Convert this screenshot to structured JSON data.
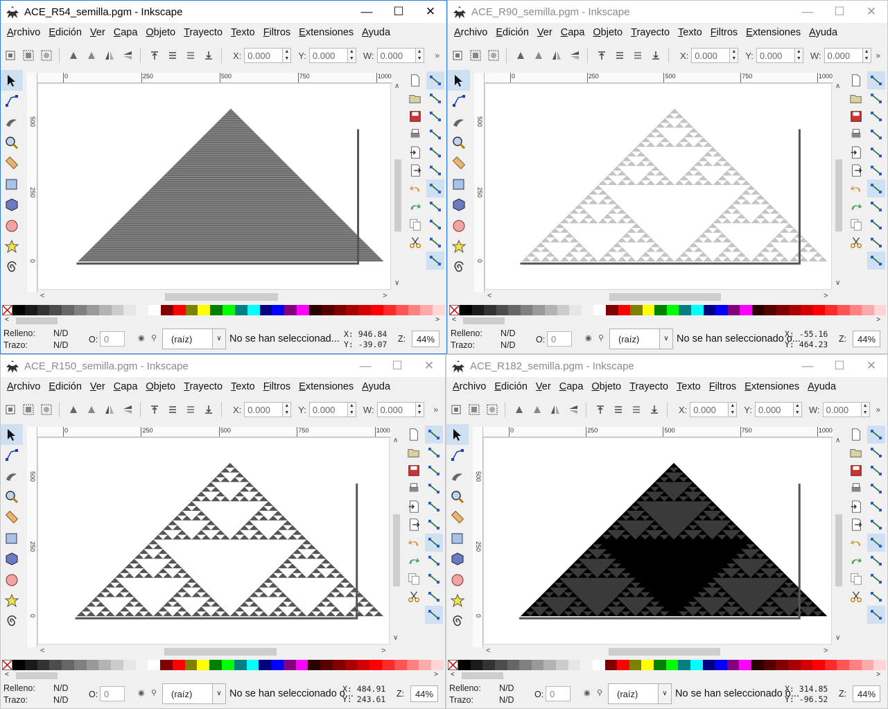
{
  "menu": [
    "Archivo",
    "Edición",
    "Ver",
    "Capa",
    "Objeto",
    "Trayecto",
    "Texto",
    "Filtros",
    "Extensiones",
    "Ayuda"
  ],
  "toolbar": {
    "x_label": "X:",
    "x_value": "0.000",
    "y_label": "Y:",
    "y_value": "0.000",
    "w_label": "W:",
    "w_value": "0.000"
  },
  "ruler": {
    "h": [
      "0",
      "250",
      "500",
      "750",
      "1000"
    ],
    "v": [
      "5\n0\n0",
      "2\n5\n0",
      "0"
    ]
  },
  "status": {
    "fill_label": "Relleno:",
    "stroke_label": "Trazo:",
    "fill_value": "N/D",
    "stroke_value": "N/D",
    "opacity_label": "O:",
    "opacity_value": "0",
    "layer": "(raíz)",
    "zoom_label": "Z:",
    "zoom": "44%"
  },
  "windows": [
    {
      "title": "ACE_R54_semilla.pgm - Inkscape",
      "message": "No se han seleccionad...",
      "x": "946.84",
      "y": "-39.07"
    },
    {
      "title": "ACE_R90_semilla.pgm - Inkscape",
      "message": "No se han seleccionado o...",
      "x": "-55.16",
      "y": "464.23"
    },
    {
      "title": "ACE_R150_semilla.pgm - Inkscape",
      "message": "No se han seleccionado o...",
      "x": "484.91",
      "y": "243.61"
    },
    {
      "title": "ACE_R182_semilla.pgm - Inkscape",
      "message": "No se han seleccionado o...",
      "x": "314.85",
      "y": "-96.52"
    }
  ],
  "palette_colors": [
    "#000000",
    "#1a1a1a",
    "#333333",
    "#4d4d4d",
    "#666666",
    "#808080",
    "#999999",
    "#b3b3b3",
    "#cccccc",
    "#e6e6e6",
    "#f2f2f2",
    "#ffffff",
    "#800000",
    "#ff0000",
    "#808000",
    "#ffff00",
    "#008000",
    "#00ff00",
    "#008080",
    "#00ffff",
    "#000080",
    "#0000ff",
    "#800080",
    "#ff00ff",
    "#2b0000",
    "#550000",
    "#800000",
    "#aa0000",
    "#d40000",
    "#ff0000",
    "#ff2a2a",
    "#ff5555",
    "#ff8080",
    "#ffaaaa",
    "#ffd5d5"
  ]
}
